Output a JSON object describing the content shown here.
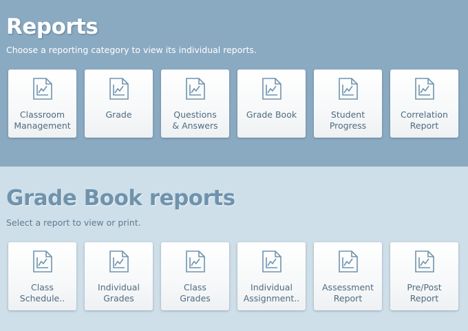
{
  "reports": {
    "title": "Reports",
    "subtitle": "Choose a reporting category to view its individual reports.",
    "categories": [
      {
        "label": "Classroom\nManagement",
        "icon": "chart-document-icon"
      },
      {
        "label": "Grade",
        "icon": "chart-document-icon"
      },
      {
        "label": "Questions\n& Answers",
        "icon": "chart-document-icon"
      },
      {
        "label": "Grade Book",
        "icon": "chart-document-icon"
      },
      {
        "label": "Student\nProgress",
        "icon": "chart-document-icon"
      },
      {
        "label": "Correlation\nReport",
        "icon": "chart-document-icon"
      }
    ]
  },
  "gradebook": {
    "title": "Grade Book reports",
    "subtitle": "Select a report to view or print.",
    "items": [
      {
        "label": "Class\nSchedule..",
        "icon": "chart-document-icon"
      },
      {
        "label": "Individual\nGrades",
        "icon": "chart-document-icon"
      },
      {
        "label": "Class\nGrades",
        "icon": "chart-document-icon"
      },
      {
        "label": "Individual\nAssignment..",
        "icon": "chart-document-icon"
      },
      {
        "label": "Assessment\nReport",
        "icon": "chart-document-icon"
      },
      {
        "label": "Pre/Post\nReport",
        "icon": "chart-document-icon"
      }
    ]
  },
  "colors": {
    "header_bg": "#8aaac2",
    "section_bg": "#cfdfe9",
    "card_text": "#4f6b80",
    "icon_stroke": "#6f93ad"
  }
}
